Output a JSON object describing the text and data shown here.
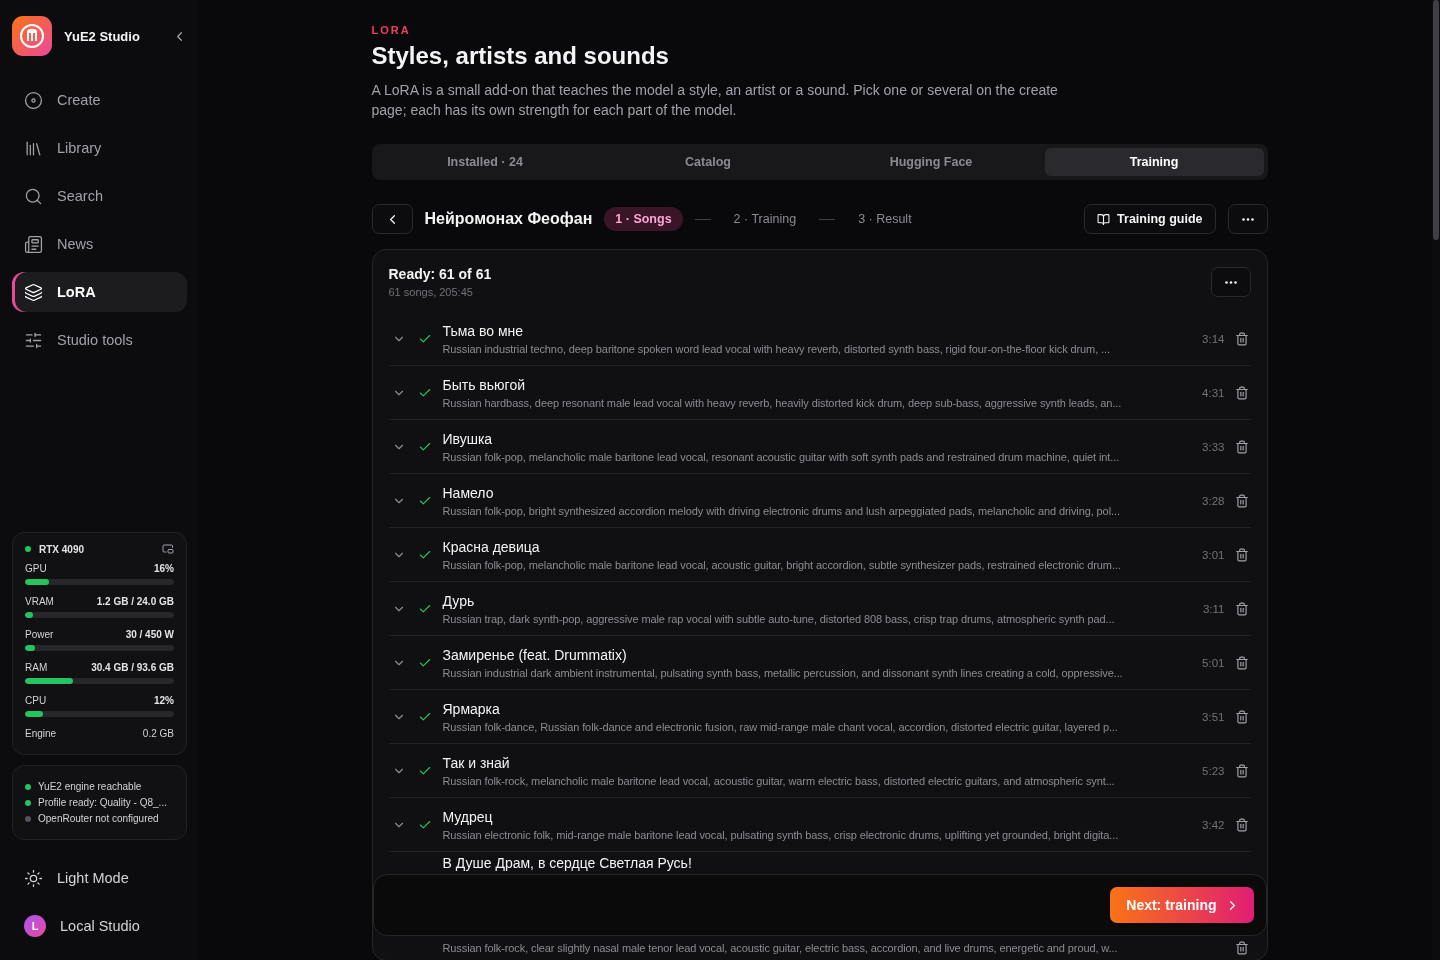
{
  "app": {
    "name": "YuE2 Studio"
  },
  "nav": [
    {
      "label": "Create",
      "selected": false
    },
    {
      "label": "Library",
      "selected": false
    },
    {
      "label": "Search",
      "selected": false
    },
    {
      "label": "News",
      "selected": false
    },
    {
      "label": "LoRA",
      "selected": true
    },
    {
      "label": "Studio tools",
      "selected": false
    }
  ],
  "gpu_card": {
    "title": "RTX 4090",
    "meters": [
      {
        "label": "GPU",
        "reading": "16%",
        "level": 0.16
      },
      {
        "label": "VRAM",
        "reading": "1.2 GB / 24.0 GB",
        "level": 0.05
      },
      {
        "label": "Power",
        "reading": "30 / 450 W",
        "level": 0.07
      },
      {
        "label": "RAM",
        "reading": "30.4 GB / 93.6 GB",
        "level": 0.32
      },
      {
        "label": "CPU",
        "reading": "12%",
        "level": 0.12
      }
    ],
    "engine": {
      "label": "Engine",
      "reading": "0.2 GB"
    }
  },
  "status": [
    {
      "text": "YuE2 engine reachable",
      "color": "#22c55e"
    },
    {
      "text": "Profile ready: Quality - Q8_...",
      "color": "#22c55e"
    },
    {
      "text": "OpenRouter not configured",
      "color": "#52525b"
    }
  ],
  "theme_toggle": "Light Mode",
  "user": {
    "initial": "L",
    "name": "Local Studio"
  },
  "page": {
    "eyebrow": "LORA",
    "title": "Styles, artists and sounds",
    "description": "A LoRA is a small add-on that teaches the model a style, an artist or a sound. Pick one or several on the create page; each has its own strength for each part of the model."
  },
  "tabs": [
    {
      "label": "Installed · 24",
      "selected": false
    },
    {
      "label": "Catalog",
      "selected": false
    },
    {
      "label": "Hugging Face",
      "selected": false
    },
    {
      "label": "Training",
      "selected": true
    }
  ],
  "project": {
    "name": "Нейромонах Феофан",
    "steps": [
      {
        "label": "1 · Songs",
        "selected": true
      },
      {
        "label": "2 · Training",
        "selected": false
      },
      {
        "label": "3 · Result",
        "selected": false
      }
    ],
    "guide_button": "Training guide"
  },
  "songs_card": {
    "title": "Ready: 61 of 61",
    "subtitle": "61 songs, 205:45",
    "songs": [
      {
        "title": "Тьма во мне",
        "description": "Russian industrial techno, deep baritone spoken word lead vocal with heavy reverb, distorted synth bass, rigid four-on-the-floor kick drum, ...",
        "duration": "3:14",
        "done": true
      },
      {
        "title": "Быть вьюгой",
        "description": "Russian hardbass, deep resonant male lead vocal with heavy reverb, heavily distorted kick drum, deep sub-bass, aggressive synth leads, an...",
        "duration": "4:31",
        "done": true
      },
      {
        "title": "Ивушка",
        "description": "Russian folk-pop, melancholic male baritone lead vocal, resonant acoustic guitar with soft synth pads and restrained drum machine, quiet int...",
        "duration": "3:33",
        "done": true
      },
      {
        "title": "Намело",
        "description": "Russian folk-pop, bright synthesized accordion melody with driving electronic drums and lush arpeggiated pads, melancholic and driving, pol...",
        "duration": "3:28",
        "done": true
      },
      {
        "title": "Красна девица",
        "description": "Russian folk-pop, melancholic male baritone lead vocal, acoustic guitar, bright accordion, subtle synthesizer pads, restrained electronic drum...",
        "duration": "3:01",
        "done": true
      },
      {
        "title": "Дурь",
        "description": "Russian trap, dark synth-pop, aggressive male rap vocal with subtle auto-tune, distorted 808 bass, crisp trap drums, atmospheric synth pad...",
        "duration": "3:11",
        "done": true
      },
      {
        "title": "Замиренье (feat. Drummatix)",
        "description": "Russian industrial dark ambient instrumental, pulsating synth bass, metallic percussion, and dissonant synth lines creating a cold, oppressive...",
        "duration": "5:01",
        "done": true
      },
      {
        "title": "Ярмарка",
        "description": "Russian folk-dance, Russian folk-dance and electronic fusion, raw mid-range male chant vocal, accordion, distorted electric guitar, layered p...",
        "duration": "3:51",
        "done": true
      },
      {
        "title": "Так и знай",
        "description": "Russian folk-rock, melancholic male baritone lead vocal, acoustic guitar, warm electric bass, distorted electric guitars, and atmospheric synt...",
        "duration": "5:23",
        "done": true
      },
      {
        "title": "Мудрец",
        "description": "Russian electronic folk, mid-range male baritone lead vocal, pulsating synth bass, crisp electronic drums, uplifting yet grounded, bright digita...",
        "duration": "3:42",
        "done": true
      }
    ],
    "covered_song": {
      "title": "В Душе Драм, в сердце Светлая Русь!"
    },
    "next_song": {
      "description": "Russian folk-rock, clear slightly nasal male tenor lead vocal, acoustic guitar, electric bass, accordion, and live drums, energetic and proud, w..."
    }
  },
  "footer": {
    "next_button": "Next: training"
  }
}
